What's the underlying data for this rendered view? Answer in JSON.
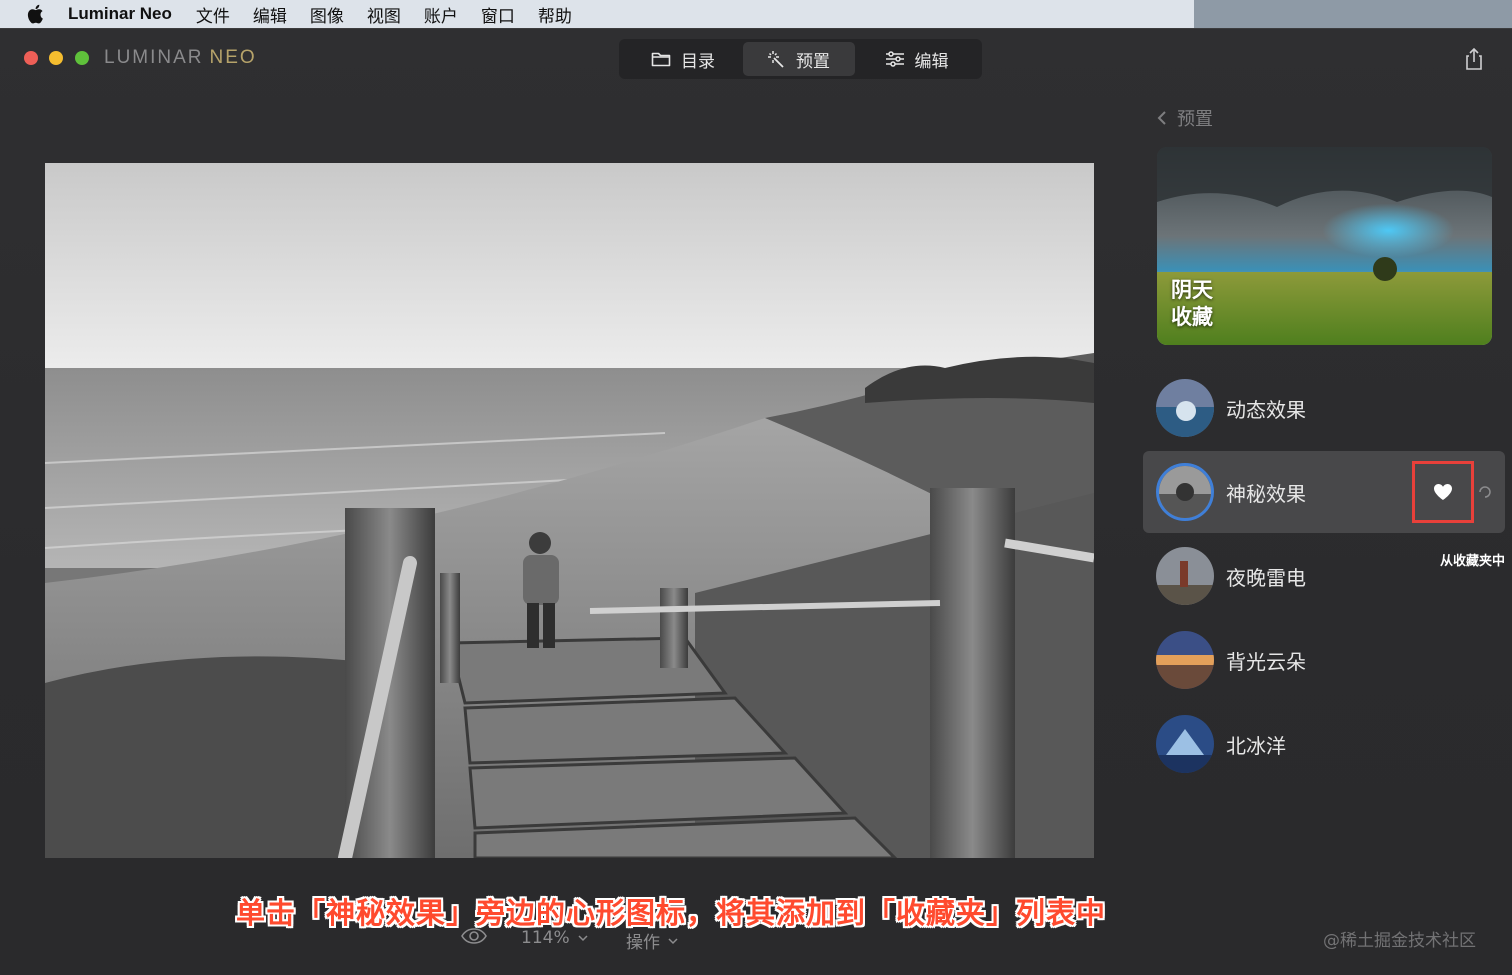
{
  "menubar": {
    "app_name": "Luminar Neo",
    "items": [
      "文件",
      "编辑",
      "图像",
      "视图",
      "账户",
      "窗口",
      "帮助"
    ]
  },
  "window": {
    "brand_main": "LUMINAR",
    "brand_accent": "NEO"
  },
  "tabs": [
    {
      "label": "目录",
      "icon": "folder-icon"
    },
    {
      "label": "预置",
      "icon": "magic-wand-icon",
      "active": true
    },
    {
      "label": "编辑",
      "icon": "sliders-icon"
    }
  ],
  "panel": {
    "back_label": "预置",
    "hero": {
      "line1": "阴天",
      "line2": "收藏"
    },
    "presets": [
      {
        "label": "动态效果",
        "selected": false
      },
      {
        "label": "神秘效果",
        "selected": true
      },
      {
        "label": "夜晚雷电",
        "selected": false
      },
      {
        "label": "背光云朵",
        "selected": false
      },
      {
        "label": "北冰洋",
        "selected": false
      }
    ],
    "tooltip": "从收藏夹中"
  },
  "bottom": {
    "zoom": "114%",
    "operations": "操作"
  },
  "annotation": "单击「神秘效果」旁边的心形图标，将其添加到「收藏夹」列表中",
  "watermark": "@稀土掘金技术社区",
  "colors": {
    "highlight_box": "#e8403a",
    "annotation_text": "#ff4a2e",
    "selected_ring": "#3f7fd8"
  }
}
